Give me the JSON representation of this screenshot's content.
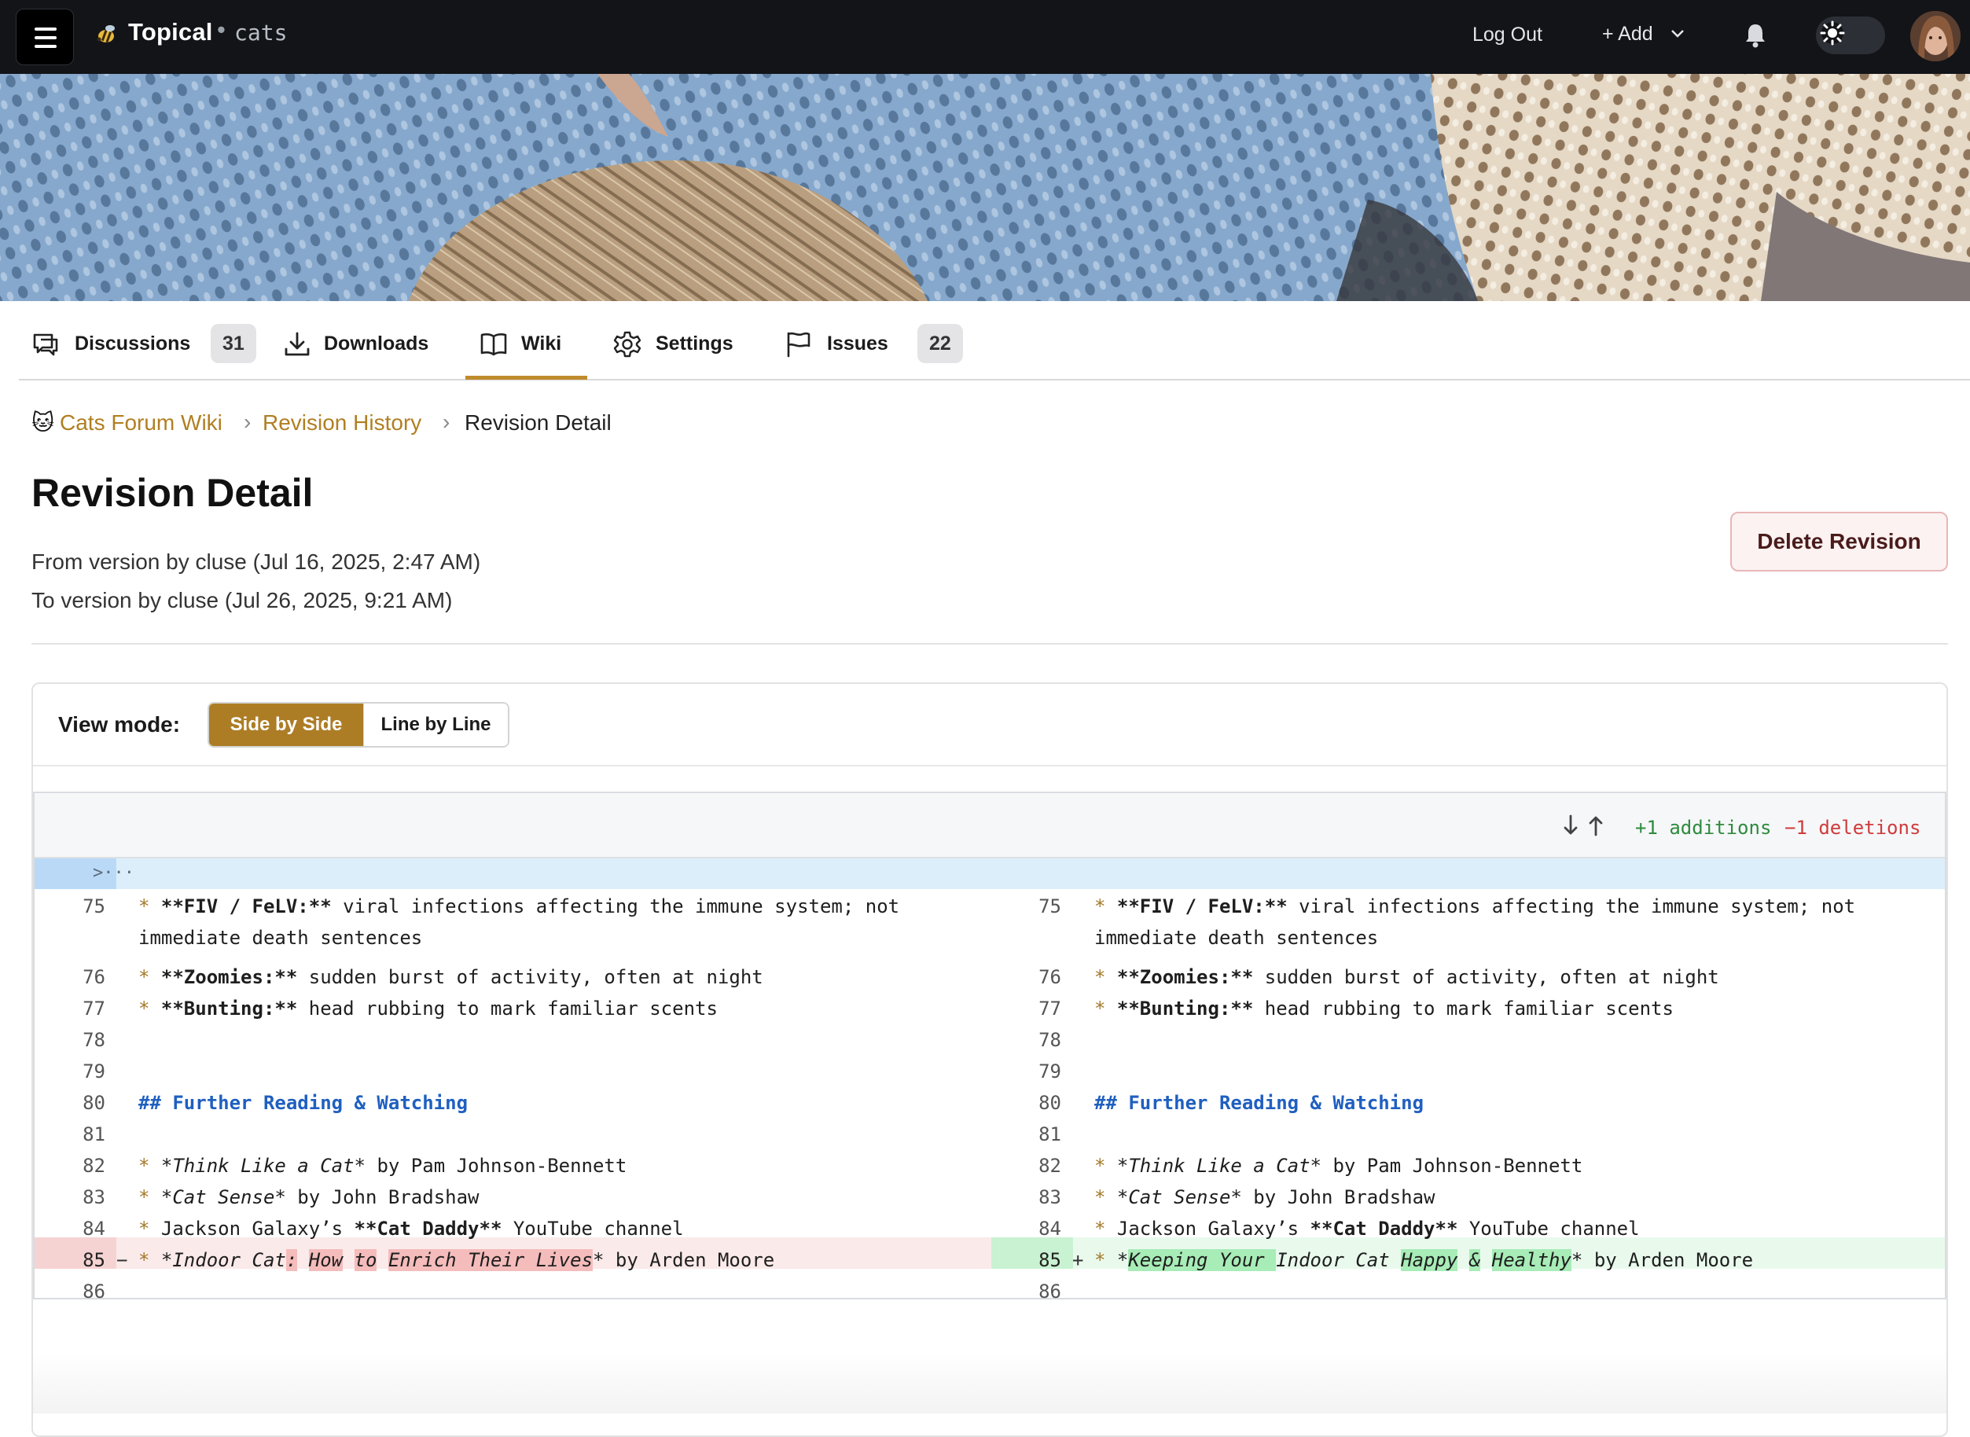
{
  "topbar": {
    "brand": "Topical",
    "separator": "•",
    "forum": "cats",
    "logout": "Log Out",
    "add": "+ Add"
  },
  "tabs": [
    {
      "label": "Discussions",
      "count": "31",
      "icon": "discussions-icon"
    },
    {
      "label": "Downloads",
      "icon": "download-icon"
    },
    {
      "label": "Wiki",
      "icon": "book-icon",
      "active": true
    },
    {
      "label": "Settings",
      "icon": "gear-icon"
    },
    {
      "label": "Issues",
      "count": "22",
      "icon": "flag-icon"
    }
  ],
  "breadcrumb": {
    "emoji": "🐱",
    "root": "Cats Forum Wiki",
    "history": "Revision History",
    "current": "Revision Detail",
    "sep": "›"
  },
  "page": {
    "title": "Revision Detail",
    "from": "From version by cluse (Jul 16, 2025, 2:47 AM)",
    "to": "To version by cluse (Jul 26, 2025, 9:21 AM)",
    "delete_label": "Delete Revision"
  },
  "view_mode": {
    "label": "View mode:",
    "side_by_side": "Side by Side",
    "line_by_line": "Line by Line",
    "selected": "Side by Side"
  },
  "diff": {
    "additions": "+1 additions",
    "deletions": "−1 deletions",
    "hunk": ">···",
    "line_numbers": [
      "75",
      "",
      "76",
      "77",
      "78",
      "79",
      "80",
      "81",
      "82",
      "83",
      "84",
      "85",
      "86"
    ],
    "colors": {
      "accent": "#ad7d26",
      "added": "#e9faed",
      "deleted": "#fbeaea",
      "heading": "#1f5fc0"
    }
  }
}
